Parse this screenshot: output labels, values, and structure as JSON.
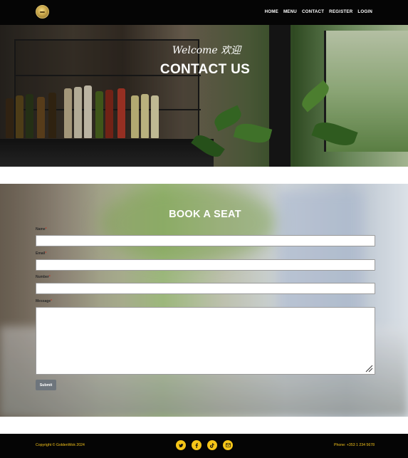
{
  "nav": {
    "links": [
      "HOME",
      "MENU",
      "CONTACT",
      "REGISTER",
      "LOGIN"
    ]
  },
  "hero": {
    "welcome": "Welcome 欢迎",
    "title": "CONTACT US"
  },
  "form": {
    "title": "BOOK A SEAT",
    "fields": {
      "name": "Name",
      "email": "Email",
      "number": "Number",
      "message": "Message"
    },
    "required_marker": "*",
    "submit_label": "Submit"
  },
  "footer": {
    "copyright": "Copyright © GoldenWok 2024",
    "phone": "Phone: +353 1 234 5678",
    "social_icons": [
      "twitter-icon",
      "facebook-icon",
      "tiktok-icon",
      "email-icon"
    ]
  },
  "colors": {
    "nav_bg": "#050505",
    "accent_gold": "#f5c518",
    "submit_bg": "#6e757c"
  }
}
